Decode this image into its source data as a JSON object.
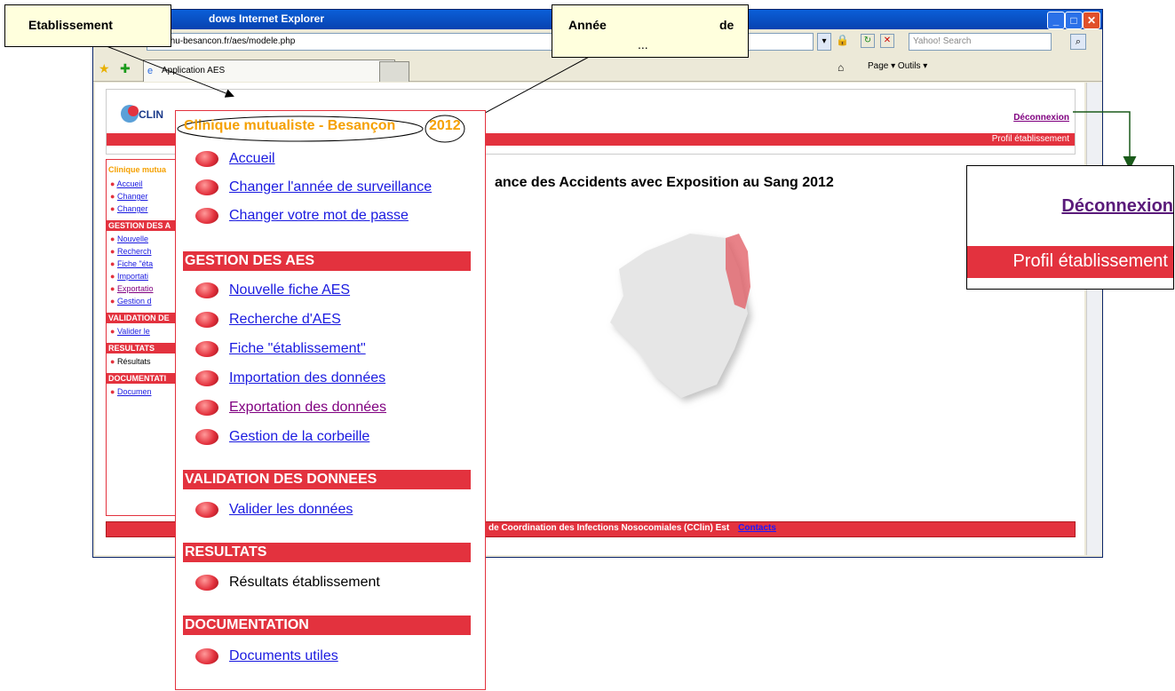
{
  "window": {
    "title": "dows Internet Explorer",
    "address": "rjet.chu-besancon.fr/aes/modele.php",
    "search_placeholder": "Yahoo! Search",
    "tab_label": "Application AES",
    "tools": "Page ▾  Outils ▾"
  },
  "page": {
    "deconnexion": "Déconnexion",
    "profil": "Profil établissement",
    "heading": "ance des Accidents avec Exposition au Sang 2012",
    "footer_text": "de Coordination des Infections Nosocomiales (CClin) Est",
    "footer_contacts": "Contacts",
    "sidebar_small": {
      "title": "Clinique mutua",
      "items": [
        "Accueil",
        "Changer",
        "Changer"
      ],
      "section_gestion": "GESTION DES A",
      "gestion_items": [
        "Nouvelle",
        "Recherch",
        "Fiche \"éta",
        "Importati",
        "Exportatio",
        "Gestion d"
      ],
      "section_validation": "VALIDATION DE",
      "validation_items": [
        "Valider le"
      ],
      "section_resultats": "RESULTATS",
      "resultats_items": [
        "Résultats"
      ],
      "section_documentation": "DOCUMENTATI",
      "documentation_items": [
        "Documen"
      ]
    }
  },
  "menu": {
    "etablissement": "Clinique mutualiste - Besançon",
    "year": "2012",
    "top_items": [
      "Accueil",
      "Changer l'année de surveillance",
      "Changer votre mot de passe"
    ],
    "section_gestion": "GESTION DES AES",
    "gestion_items": [
      "Nouvelle fiche AES",
      "Recherche d'AES",
      "Fiche \"établissement\"",
      "Importation des données",
      "Exportation des données",
      "Gestion de la corbeille"
    ],
    "section_validation": "VALIDATION DES DONNEES",
    "validation_items": [
      "Valider les données"
    ],
    "section_resultats": "RESULTATS",
    "resultats_items": [
      "Résultats établissement"
    ],
    "section_documentation": "DOCUMENTATION",
    "documentation_items": [
      "Documents utiles"
    ]
  },
  "callouts": {
    "etablissement": "Etablissement",
    "annee": "Année",
    "annee_de": "de",
    "annee_dots": "..."
  },
  "zoom": {
    "deconnexion": "Déconnexion",
    "profil": "Profil établissement"
  },
  "colors": {
    "accent_red": "#e3323e",
    "title_orange": "#f5a000",
    "link_blue": "#1a1ae0",
    "visited_purple": "#800080"
  }
}
